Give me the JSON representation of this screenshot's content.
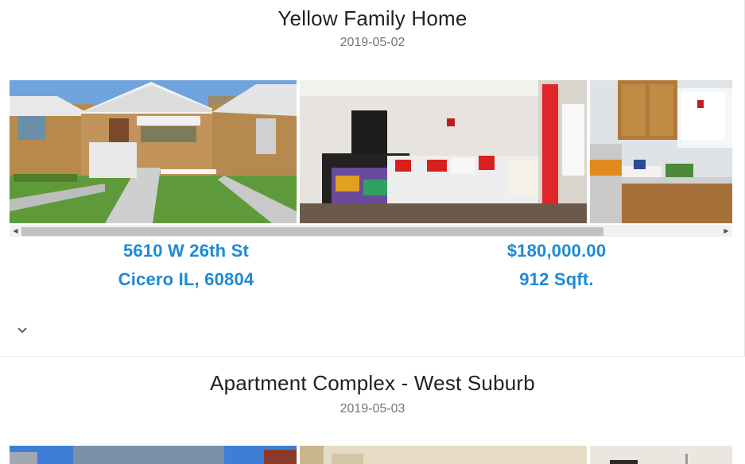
{
  "listings": [
    {
      "title": "Yellow Family Home",
      "date": "2019-05-02",
      "address_line1": "5610 W 26th St",
      "address_line2": "Cicero IL, 60804",
      "price": "$180,000.00",
      "area": "912 Sqft.",
      "photos": [
        "house-exterior",
        "living-room",
        "kitchen"
      ]
    },
    {
      "title": "Apartment Complex - West Suburb",
      "date": "2019-05-03",
      "photos": [
        "building-exterior",
        "interior-room",
        "interior-doorway"
      ]
    }
  ],
  "icons": {
    "expand": "chevron-down-icon",
    "scroll_left": "scroll-left-arrow-icon",
    "scroll_right": "scroll-right-arrow-icon"
  },
  "colors": {
    "accent": "#1c8ad6",
    "title": "#222222",
    "date": "#757575"
  }
}
